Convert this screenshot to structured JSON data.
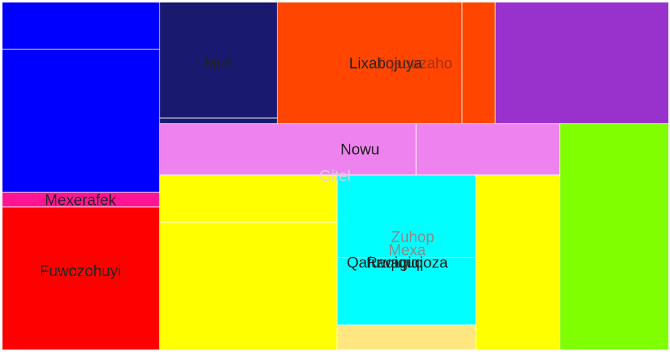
{
  "chart_data": {
    "type": "treemap",
    "title": "",
    "groups": [
      {
        "name": "",
        "color": "#0000ff",
        "children": [
          {
            "name": "",
            "value": 15.3
          },
          {
            "name": "",
            "value": 46.7
          }
        ]
      },
      {
        "name": "Mexerafek",
        "color": "#ff1493",
        "children": [
          {
            "name": "Mexerafek",
            "value": 4.9
          }
        ]
      },
      {
        "name": "Fuwozohuyi",
        "color": "#ff0000",
        "children": [
          {
            "name": "Fuwozohuyi",
            "value": 46.4
          }
        ]
      },
      {
        "name": "Muti",
        "color": "#191970",
        "children": [
          {
            "name": "Muti",
            "value": 28.6
          },
          {
            "name": "",
            "value": 1.4
          }
        ]
      },
      {
        "name": "Lixabojuya",
        "color": "#ff4500",
        "children": [
          {
            "name": "Lixabojuya",
            "value": 46.9
          },
          {
            "name": "Jiqaqazaho",
            "value": 8.4
          }
        ]
      },
      {
        "name": "",
        "color": "#9932cc",
        "children": [
          {
            "name": "",
            "value": 43.5
          }
        ]
      },
      {
        "name": "Nowu",
        "color": "#ee82ee",
        "children": [
          {
            "name": "Nowu",
            "value": 27.1
          },
          {
            "name": "",
            "value": 15.0
          }
        ]
      },
      {
        "name": "Gitel",
        "color": "#ffff00",
        "children": [
          {
            "name": "",
            "value": 17.3
          },
          {
            "name": "Qafuwagiqi",
            "value": 46.4
          },
          {
            "name": "",
            "value": 26.1
          }
        ]
      },
      {
        "name": "Mexa",
        "color": "#00ffff",
        "children": [
          {
            "name": "Zuhop",
            "value": 23.2
          },
          {
            "name": "Raqiquqoza",
            "value": 21.5
          },
          {
            "name": "",
            "value": 6.8
          }
        ]
      },
      {
        "name": "",
        "color": "#7fff00",
        "children": [
          {
            "name": "",
            "value": 51.4
          }
        ]
      }
    ],
    "tile_colors": {
      "mexa_extra": "#ffe680"
    }
  }
}
